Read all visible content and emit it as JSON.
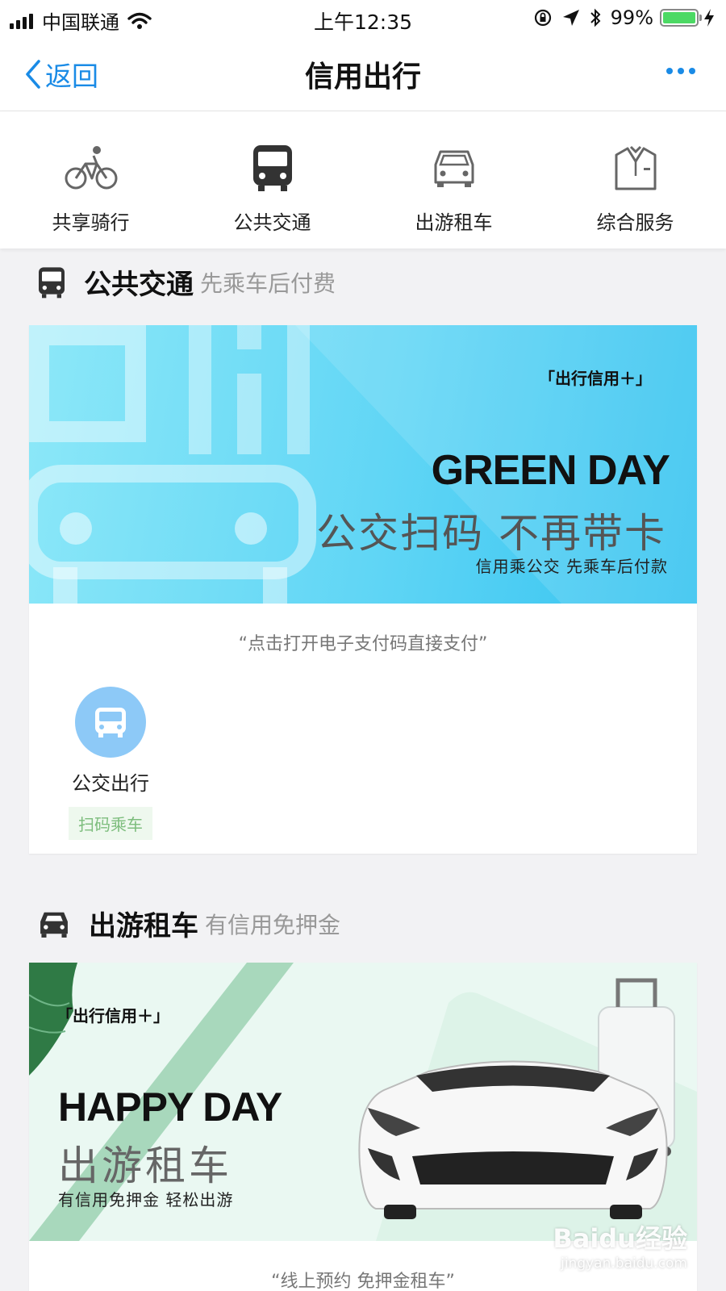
{
  "status_bar": {
    "carrier": "中国联通",
    "time": "上午12:35",
    "battery": "99%",
    "battery_level": 0.99,
    "icons": [
      "signal-icon",
      "wifi-icon",
      "rotation-lock-icon",
      "location-arrow-icon",
      "bluetooth-icon",
      "battery-icon",
      "charging-icon"
    ]
  },
  "nav": {
    "back_label": "返回",
    "title": "信用出行",
    "more_icon": "more-dots-icon",
    "accent_color": "#1a8be6"
  },
  "tabs": [
    {
      "label": "共享骑行",
      "icon": "bicycle-icon"
    },
    {
      "label": "公共交通",
      "icon": "bus-icon"
    },
    {
      "label": "出游租车",
      "icon": "car-icon"
    },
    {
      "label": "综合服务",
      "icon": "suit-icon"
    }
  ],
  "sections": {
    "transit": {
      "title": "公共交通",
      "subtitle": "先乘车后付费",
      "icon": "bus-icon",
      "banner": {
        "tag": "「出行信用＋」",
        "headline": "GREEN DAY",
        "slogan": "公交扫码  不再带卡",
        "sub": "信用乘公交  先乘车后付款"
      },
      "caption": "“点击打开电子支付码直接支付”",
      "service": {
        "label": "公交出行",
        "badge": "扫码乘车",
        "icon": "bus-icon",
        "circle_color": "#8dc9f7"
      }
    },
    "rental": {
      "title": "出游租车",
      "subtitle": "有信用免押金",
      "icon": "car-icon",
      "banner": {
        "tag": "「出行信用＋」",
        "headline": "HAPPY DAY",
        "slogan": "出游租车",
        "sub": "有信用免押金  轻松出游"
      },
      "caption": "“线上预约 免押金租车”"
    }
  },
  "watermark": {
    "brand": "Baidu经验",
    "url": "jingyan.baidu.com"
  }
}
